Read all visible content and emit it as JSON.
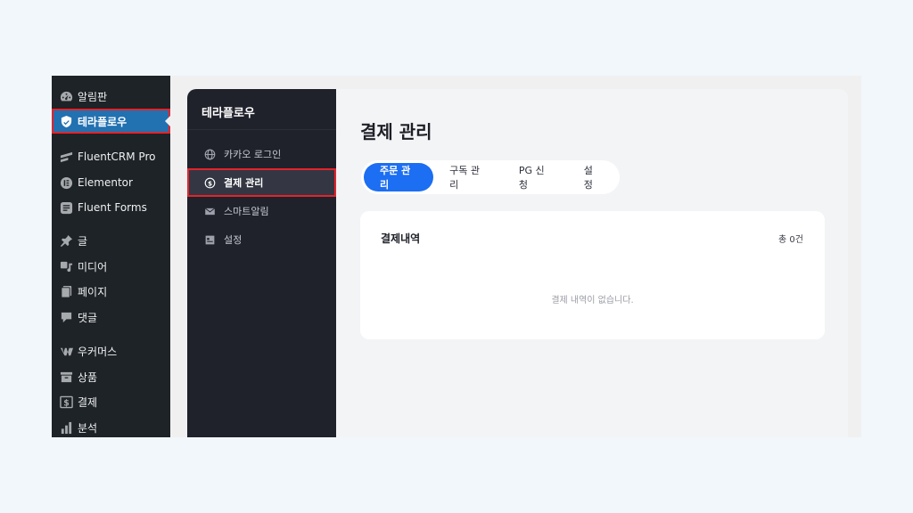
{
  "wp_menu": {
    "items": [
      {
        "label": "알림판",
        "icon": "dashboard-icon"
      },
      {
        "label": "테라플로우",
        "icon": "shield-icon",
        "active": true
      },
      {
        "label": "FluentCRM Pro",
        "icon": "fluentcrm-icon"
      },
      {
        "label": "Elementor",
        "icon": "elementor-icon"
      },
      {
        "label": "Fluent Forms",
        "icon": "forms-icon"
      },
      {
        "label": "글",
        "icon": "pin-icon"
      },
      {
        "label": "미디어",
        "icon": "media-icon"
      },
      {
        "label": "페이지",
        "icon": "pages-icon"
      },
      {
        "label": "댓글",
        "icon": "comment-icon"
      },
      {
        "label": "우커머스",
        "icon": "woocommerce-icon"
      },
      {
        "label": "상품",
        "icon": "archive-icon"
      },
      {
        "label": "결제",
        "icon": "payment-icon"
      },
      {
        "label": "분석",
        "icon": "chart-icon"
      }
    ]
  },
  "plugin_nav": {
    "title": "테라플로우",
    "items": [
      {
        "label": "카카오 로그인",
        "icon": "globe-icon"
      },
      {
        "label": "결제 관리",
        "icon": "dollar-icon",
        "active": true
      },
      {
        "label": "스마트알림",
        "icon": "mail-icon"
      },
      {
        "label": "설정",
        "icon": "settings-icon"
      }
    ]
  },
  "main": {
    "title": "결제 관리",
    "tabs": [
      {
        "label": "주문 관리",
        "active": true
      },
      {
        "label": "구독 관리"
      },
      {
        "label": "PG 신청"
      },
      {
        "label": "설정"
      }
    ],
    "card": {
      "title": "결제내역",
      "count": "총 0건",
      "empty": "결제 내역이 없습니다."
    }
  },
  "colors": {
    "accent": "#1c6ef2",
    "wp_active": "#2271b1",
    "highlight_outline": "#e3242b"
  }
}
